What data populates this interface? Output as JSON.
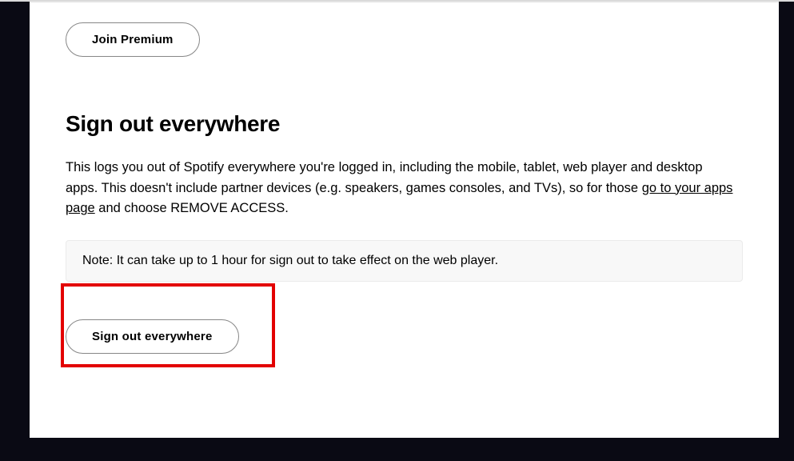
{
  "buttons": {
    "join_premium": "Join Premium",
    "sign_out_everywhere": "Sign out everywhere"
  },
  "section": {
    "heading": "Sign out everywhere",
    "desc_part1": "This logs you out of Spotify everywhere you're logged in, including the mobile, tablet, web player and desktop apps. This doesn't include partner devices (e.g. speakers, games consoles, and TVs), so for those ",
    "desc_link": "go to your apps page",
    "desc_part2": " and choose REMOVE ACCESS.",
    "note": "Note: It can take up to 1 hour for sign out to take effect on the web player."
  }
}
